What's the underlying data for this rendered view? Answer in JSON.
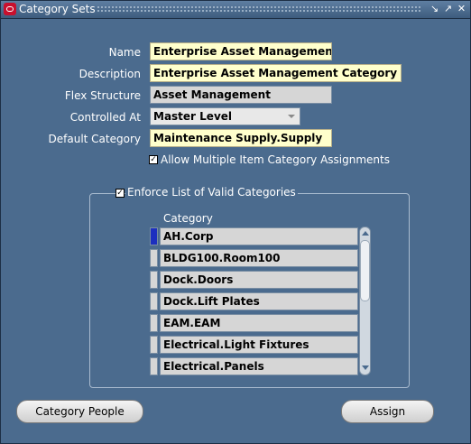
{
  "window": {
    "title": "Category Sets"
  },
  "form": {
    "name": {
      "label": "Name",
      "value": "Enterprise Asset Management"
    },
    "description": {
      "label": "Description",
      "value": "Enterprise Asset Management Category Set"
    },
    "flex_structure": {
      "label": "Flex Structure",
      "value": "Asset Management"
    },
    "controlled_at": {
      "label": "Controlled At",
      "value": "Master Level"
    },
    "default_category": {
      "label": "Default Category",
      "value": "Maintenance Supply.Supply"
    },
    "allow_multiple": {
      "label": "Allow Multiple Item Category Assignments",
      "checked": true
    }
  },
  "valid_categories": {
    "title": "Enforce List of Valid Categories",
    "enforced": true,
    "column_header": "Category",
    "rows": [
      "AH.Corp",
      "BLDG100.Room100",
      "Dock.Doors",
      "Dock.Lift Plates",
      "EAM.EAM",
      "Electrical.Light Fixtures",
      "Electrical.Panels"
    ]
  },
  "buttons": {
    "category_people": "Category People",
    "assign": "Assign"
  },
  "icons": {
    "app_icon": "oracle-icon",
    "minimize": "minimize-icon",
    "maximize": "maximize-icon",
    "close": "close-icon"
  }
}
